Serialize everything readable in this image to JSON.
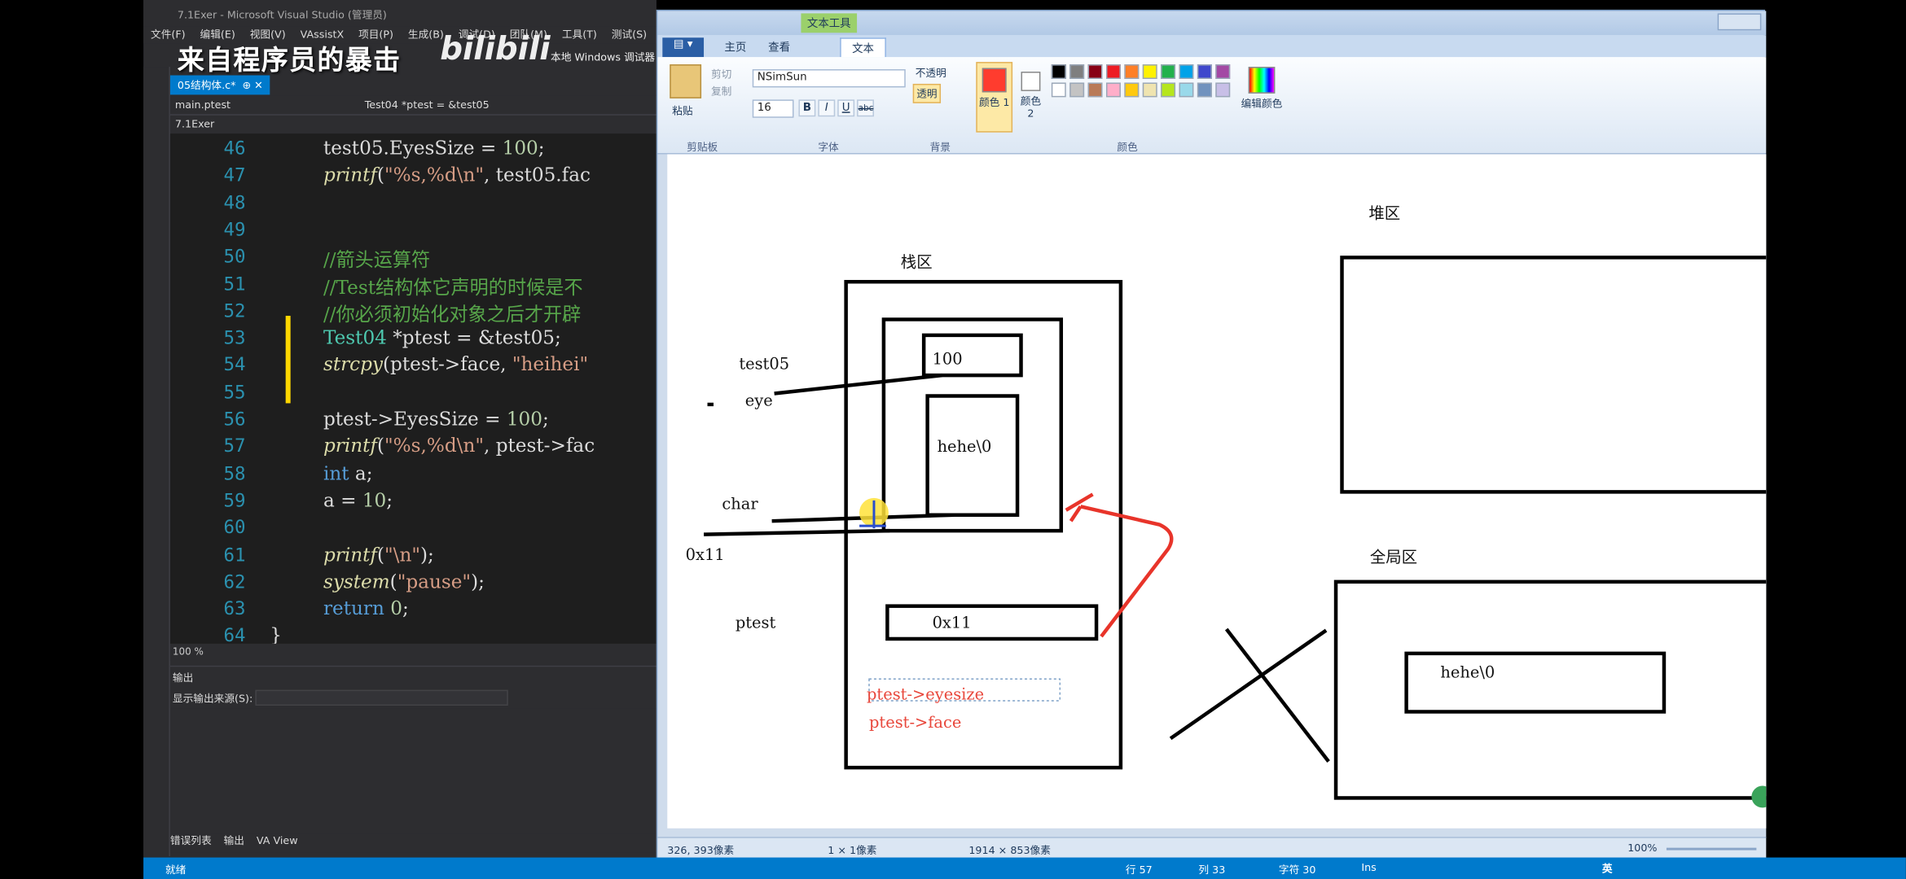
{
  "vs": {
    "title": "7.1Exer - Microsoft Visual Studio (管理员)",
    "menu": [
      "文件(F)",
      "编辑(E)",
      "视图(V)",
      "VAssistX",
      "项目(P)",
      "生成(B)",
      "调试(D)",
      "团队(M)",
      "工具(T)",
      "测试(S)"
    ],
    "watermark": "来自程序员的暴击",
    "watermark_logo": "bilibili",
    "debug_target": "本地 Windows 调试器",
    "tab": "05结构体.c*",
    "nav_scope": "main.ptest",
    "nav_member": "Test04 *ptest = &test05",
    "nav_project": "7.1Exer",
    "zoom": "100 %",
    "output_title": "输出",
    "output_source_label": "显示输出来源(S):",
    "bottom_tabs": [
      "错误列表",
      "输出",
      "VA View"
    ],
    "code_lines": [
      {
        "n": "46",
        "parts": [
          {
            "c": "",
            "t": "test05.EyesSize = "
          },
          {
            "c": "n",
            "t": "100"
          },
          {
            "c": "",
            "t": ";"
          }
        ]
      },
      {
        "n": "47",
        "parts": [
          {
            "c": "f",
            "t": "printf"
          },
          {
            "c": "",
            "t": "("
          },
          {
            "c": "s",
            "t": "\"%s,%d\\n\""
          },
          {
            "c": "",
            "t": ", test05.fac"
          }
        ]
      },
      {
        "n": "48",
        "parts": []
      },
      {
        "n": "49",
        "parts": []
      },
      {
        "n": "50",
        "parts": [
          {
            "c": "c",
            "t": "//箭头运算符"
          }
        ]
      },
      {
        "n": "51",
        "parts": [
          {
            "c": "c",
            "t": "//Test结构体它声明的时候是不"
          }
        ]
      },
      {
        "n": "52",
        "parts": [
          {
            "c": "c",
            "t": "//你必须初始化对象之后才开辟"
          }
        ]
      },
      {
        "n": "53",
        "parts": [
          {
            "c": "t",
            "t": "Test04"
          },
          {
            "c": "",
            "t": " *ptest = &test05;"
          }
        ]
      },
      {
        "n": "54",
        "parts": [
          {
            "c": "f",
            "t": "strcpy"
          },
          {
            "c": "",
            "t": "(ptest->face, "
          },
          {
            "c": "s",
            "t": "\"heihei\""
          }
        ]
      },
      {
        "n": "55",
        "parts": []
      },
      {
        "n": "56",
        "parts": [
          {
            "c": "",
            "t": "ptest->EyesSize = "
          },
          {
            "c": "n",
            "t": "100"
          },
          {
            "c": "",
            "t": ";"
          }
        ]
      },
      {
        "n": "57",
        "parts": [
          {
            "c": "f",
            "t": "printf"
          },
          {
            "c": "",
            "t": "("
          },
          {
            "c": "s",
            "t": "\"%s,%d\\n\""
          },
          {
            "c": "",
            "t": ", ptest->fac"
          }
        ]
      },
      {
        "n": "58",
        "parts": [
          {
            "c": "k",
            "t": "int"
          },
          {
            "c": "",
            "t": " a;"
          }
        ]
      },
      {
        "n": "59",
        "parts": [
          {
            "c": "",
            "t": "a = "
          },
          {
            "c": "n",
            "t": "10"
          },
          {
            "c": "",
            "t": ";"
          }
        ]
      },
      {
        "n": "60",
        "parts": []
      },
      {
        "n": "61",
        "parts": [
          {
            "c": "f",
            "t": "printf"
          },
          {
            "c": "",
            "t": "("
          },
          {
            "c": "s",
            "t": "\"\\n\""
          },
          {
            "c": "",
            "t": ");"
          }
        ]
      },
      {
        "n": "62",
        "parts": [
          {
            "c": "f",
            "t": "system"
          },
          {
            "c": "",
            "t": "("
          },
          {
            "c": "s",
            "t": "\"pause\""
          },
          {
            "c": "",
            "t": ");"
          }
        ]
      },
      {
        "n": "63",
        "parts": [
          {
            "c": "k",
            "t": "return"
          },
          {
            "c": "",
            "t": " "
          },
          {
            "c": "n",
            "t": "0"
          },
          {
            "c": "",
            "t": ";"
          }
        ]
      },
      {
        "n": "64",
        "parts": [
          {
            "c": "",
            "t": "}"
          }
        ]
      }
    ]
  },
  "paint": {
    "tabs": {
      "home": "主页",
      "view": "查看",
      "text": "文本",
      "context": "文本工具"
    },
    "clipboard": {
      "paste": "粘贴",
      "cut": "剪切",
      "copy": "复制",
      "group": "剪贴板"
    },
    "font": {
      "name": "NSimSun",
      "size": "16",
      "bold": "B",
      "italic": "I",
      "underline": "U",
      "strike": "abc",
      "group": "字体"
    },
    "background": {
      "opaque": "不透明",
      "transparent": "透明",
      "group": "背景"
    },
    "colors": {
      "color1": "颜色 1",
      "color2": "颜色 2",
      "edit": "编辑颜色",
      "group": "颜色"
    },
    "status": {
      "cursor": "326, 393像素",
      "selection": "1 × 1像素",
      "size": "1914 × 853像素",
      "zoom": "100%"
    },
    "palette": [
      "#000000",
      "#7f7f7f",
      "#880015",
      "#ed1c24",
      "#ff7f27",
      "#fff200",
      "#22b14c",
      "#00a2e8",
      "#3f48cc",
      "#a349a4",
      "#ffffff",
      "#c3c3c3",
      "#b97a57",
      "#ffaec9",
      "#ffc90e",
      "#efe4b0",
      "#b5e61d",
      "#99d9ea",
      "#7092be",
      "#c8bfe7"
    ]
  },
  "drawing": {
    "heap_title": "堆区",
    "stack_title": "栈区",
    "global_title": "全局区",
    "test05": "test05",
    "eye": "eye",
    "val100": "100",
    "hehe": "hehe\\0",
    "char": "char",
    "addr": "0x11",
    "ptest": "ptest",
    "ptest_val": "0x11",
    "arrow_eyesize": "ptest->eyesize",
    "arrow_face": "ptest->face",
    "global_hehe": "hehe\\0"
  },
  "statusbar": {
    "ready": "就绪",
    "row": "行 57",
    "col": "列 33",
    "ch": "字符 30",
    "ins": "Ins"
  },
  "tray": {
    "ime": "英"
  }
}
